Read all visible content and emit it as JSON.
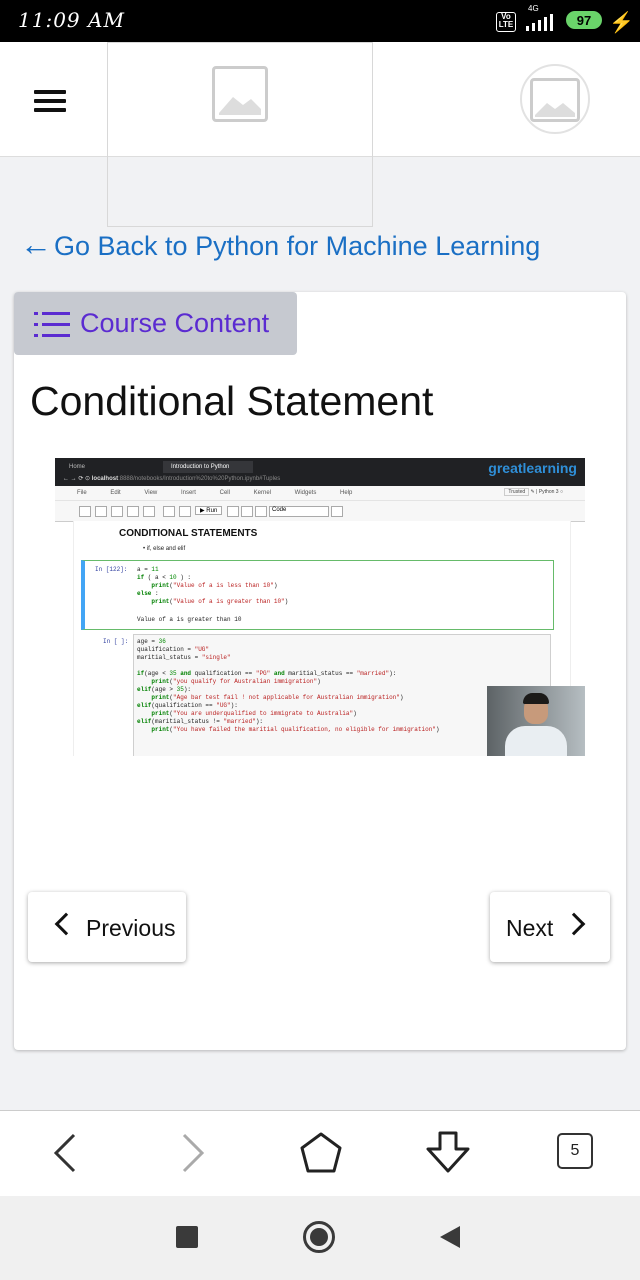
{
  "status_bar": {
    "time": "11:09 AM",
    "volte": "Vo LTE",
    "network": "4G",
    "battery": "97"
  },
  "header": {
    "menu_icon": "hamburger-menu-icon",
    "logo_icon": "image-placeholder-icon",
    "avatar_icon": "image-placeholder-icon"
  },
  "back_link": {
    "arrow": "←",
    "label": "Go Back to Python for Machine Learning"
  },
  "course_content_button": {
    "icon": "list-icon",
    "label": "Course Content"
  },
  "lesson": {
    "title": "Conditional Statement"
  },
  "video": {
    "browser": {
      "tabs": [
        "Home",
        "Introduction to Python"
      ],
      "url_host": "localhost",
      "url_path": ":8888/notebooks/Introduction%20to%20Python.ipynb#Tuples",
      "brand": "greatlearning"
    },
    "notebook": {
      "menus": [
        "File",
        "Edit",
        "View",
        "Insert",
        "Cell",
        "Kernel",
        "Widgets",
        "Help"
      ],
      "trusted": "Trusted",
      "kernel": "Python 3",
      "run_label": "Run",
      "cell_type": "Code",
      "heading": "CONDITIONAL STATEMENTS",
      "bullet": "if, else and elif",
      "cell1_prompt": "In [122]:",
      "cell1_output": "Value of a is greater than 10",
      "cell2_prompt": "In [ ]:"
    }
  },
  "navigation": {
    "previous_label": "Previous",
    "next_label": "Next"
  },
  "browser_bar": {
    "tab_count": "5"
  },
  "colors": {
    "link_blue": "#1a6fc4",
    "course_purple": "#5b2bd1",
    "course_button_bg": "#c6c9d0"
  }
}
